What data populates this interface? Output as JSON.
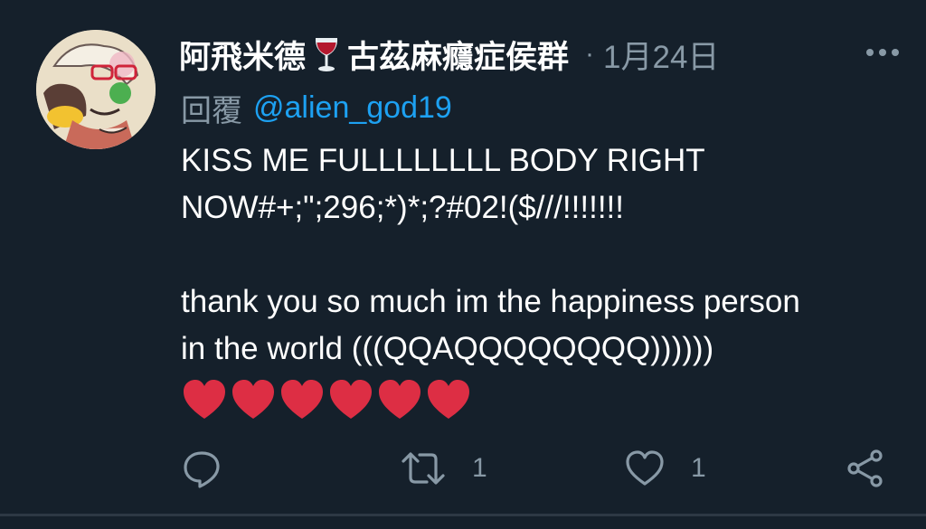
{
  "tweet": {
    "display_name": "阿飛米德",
    "display_name_suffix": "古茲麻癮症侯群",
    "name_emoji": "wine-glass-icon",
    "date": "1月24日",
    "reply_prefix": "回覆",
    "reply_to": "@alien_god19",
    "body_lines": [
      "KISS ME FULLLLLLLL BODY RIGHT",
      "NOW#+;\";296;*)*;?#02!($///!!!!!!!",
      "",
      "thank you so much im the happiness person",
      "in the world (((QQAQQQQQQQQ))))))"
    ],
    "hearts_count": 6,
    "heart_color": "#dd2e44"
  },
  "actions": {
    "reply_count": "",
    "retweet_count": "1",
    "like_count": "1"
  },
  "colors": {
    "background": "#15202b",
    "secondary_text": "#8899a6",
    "link": "#1da1f2"
  }
}
